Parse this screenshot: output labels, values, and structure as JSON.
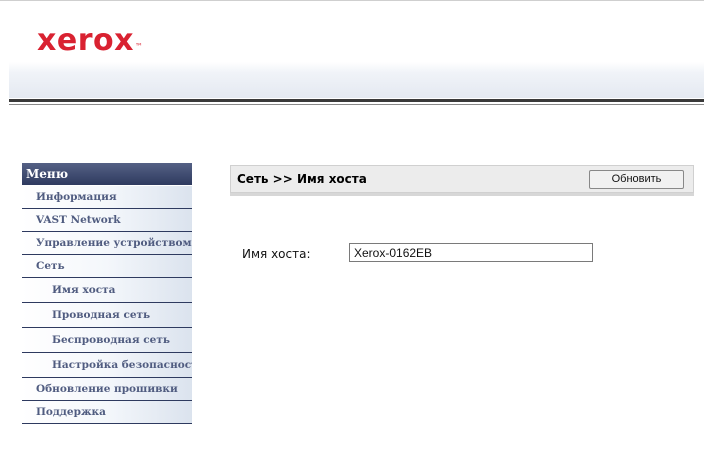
{
  "brand": {
    "logo_text": "xerox",
    "trademark": "™"
  },
  "menu": {
    "header": "Меню",
    "items": [
      {
        "label": "Информация",
        "level": 1
      },
      {
        "label": "VAST Network",
        "level": 1
      },
      {
        "label": "Управление устройством",
        "level": 1
      },
      {
        "label": "Сеть",
        "level": 1
      },
      {
        "label": "Имя хоста",
        "level": 2
      },
      {
        "label": "Проводная сеть",
        "level": 2
      },
      {
        "label": "Беспроводная сеть",
        "level": 2
      },
      {
        "label": "Настройка безопасности",
        "level": 2
      },
      {
        "label": "Обновление прошивки",
        "level": 1
      },
      {
        "label": "Поддержка",
        "level": 1
      }
    ]
  },
  "content": {
    "breadcrumb": "Сеть >> Имя хоста",
    "refresh_label": "Обновить",
    "hostname_label": "Имя хоста:",
    "hostname_value": "Xerox-0162EB"
  }
}
